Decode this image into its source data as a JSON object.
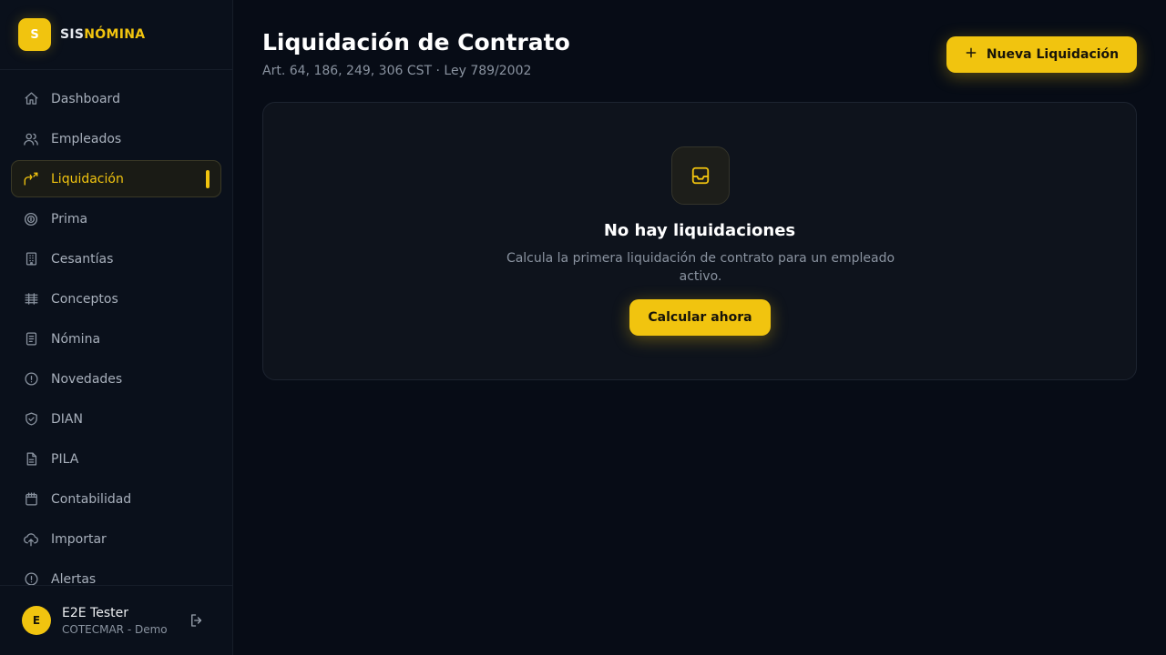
{
  "brand": {
    "logo_letter": "S",
    "name_part1": "SIS",
    "name_part2": "NÓMINA",
    "accent_color": "#f1c40f"
  },
  "sidebar": {
    "items": [
      {
        "label": "Dashboard",
        "icon": "home-icon",
        "active": false
      },
      {
        "label": "Empleados",
        "icon": "users-icon",
        "active": false
      },
      {
        "label": "Liquidación",
        "icon": "handshake-icon",
        "active": true
      },
      {
        "label": "Prima",
        "icon": "badge-icon",
        "active": false
      },
      {
        "label": "Cesantías",
        "icon": "building-icon",
        "active": false
      },
      {
        "label": "Conceptos",
        "icon": "table-icon",
        "active": false
      },
      {
        "label": "Nómina",
        "icon": "receipt-icon",
        "active": false
      },
      {
        "label": "Novedades",
        "icon": "alert-circle-icon",
        "active": false
      },
      {
        "label": "DIAN",
        "icon": "shield-check-icon",
        "active": false
      },
      {
        "label": "PILA",
        "icon": "file-icon",
        "active": false
      },
      {
        "label": "Contabilidad",
        "icon": "calendar-icon",
        "active": false
      },
      {
        "label": "Importar",
        "icon": "upload-cloud-icon",
        "active": false
      },
      {
        "label": "Alertas",
        "icon": "alert-icon",
        "active": false
      }
    ]
  },
  "user": {
    "initial": "E",
    "name": "E2E Tester",
    "org": "COTECMAR - Demo"
  },
  "header": {
    "title": "Liquidación de Contrato",
    "subtitle": "Art. 64, 186, 249, 306 CST · Ley 789/2002",
    "new_button_label": "Nueva Liquidación"
  },
  "empty_state": {
    "title": "No hay liquidaciones",
    "description": "Calcula la primera liquidación de contrato para un empleado activo.",
    "action_label": "Calcular ahora"
  }
}
